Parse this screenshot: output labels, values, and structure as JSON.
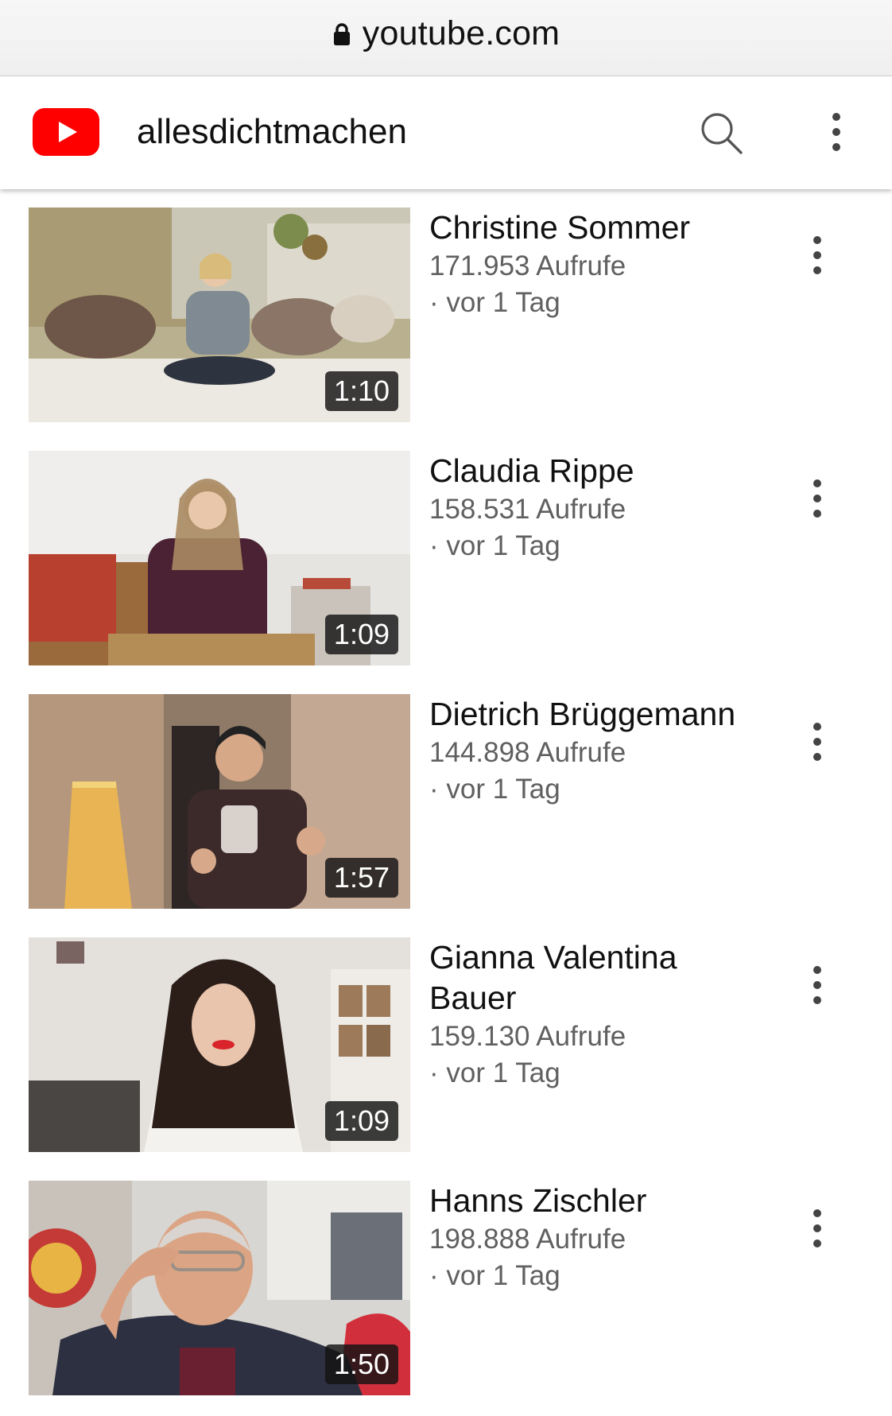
{
  "browser": {
    "url": "youtube.com"
  },
  "header": {
    "channel_name": "allesdichtmachen",
    "logo_icon": "youtube-logo-icon",
    "search_icon": "search-icon",
    "menu_icon": "more-vert-icon"
  },
  "colors": {
    "youtube_red": "#ff0000",
    "secondary_text": "#606060"
  },
  "videos": [
    {
      "title": "Christine Sommer",
      "views": "171.953 Aufrufe",
      "age": "· vor 1 Tag",
      "duration": "1:10"
    },
    {
      "title": "Claudia Rippe",
      "views": "158.531 Aufrufe",
      "age": "· vor 1 Tag",
      "duration": "1:09"
    },
    {
      "title": "Dietrich Brüggemann",
      "views": "144.898 Aufrufe",
      "age": "· vor 1 Tag",
      "duration": "1:57"
    },
    {
      "title": "Gianna Valentina Bauer",
      "views": "159.130 Aufrufe",
      "age": "· vor 1 Tag",
      "duration": "1:09"
    },
    {
      "title": "Hanns Zischler",
      "views": "198.888 Aufrufe",
      "age": "· vor 1 Tag",
      "duration": "1:50"
    }
  ]
}
